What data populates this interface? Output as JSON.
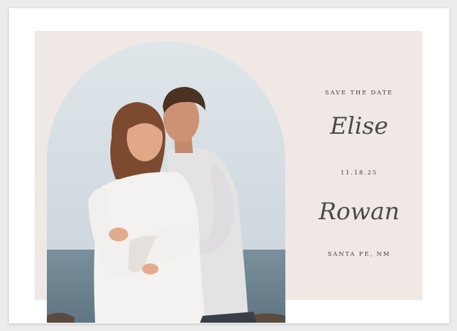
{
  "invitation": {
    "heading": "SAVE THE DATE",
    "name_one": "Elise",
    "date": "11.18.25",
    "name_two": "Rowan",
    "location": "SANTA FE, NM"
  },
  "colors": {
    "background": "#ececec",
    "card": "#ffffff",
    "panel": "#f0e8e5",
    "text": "#3d3d3d",
    "sky": "#cfdbe3",
    "sea": "#6f8795"
  },
  "photo": {
    "description_icon": "couple-photo"
  }
}
